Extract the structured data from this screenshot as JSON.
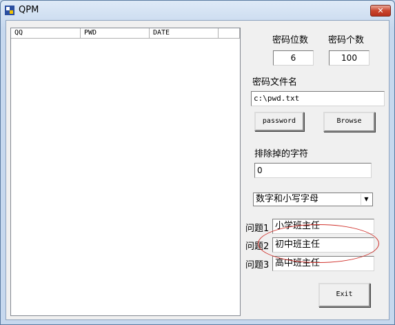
{
  "window": {
    "title": "QPM",
    "close_symbol": "✕"
  },
  "list": {
    "columns": [
      "QQ",
      "PWD",
      "DATE",
      ""
    ]
  },
  "password_length": {
    "label": "密码位数",
    "value": "6"
  },
  "password_count": {
    "label": "密码个数",
    "value": "100"
  },
  "file": {
    "label": "密码文件名",
    "value": "c:\\pwd.txt"
  },
  "buttons": {
    "password": "password",
    "browse": "Browse",
    "exit": "Exit"
  },
  "exclude": {
    "label": "排除掉的字符",
    "value": "0"
  },
  "charset": {
    "selected": "数字和小写字母"
  },
  "questions": [
    {
      "label": "问题1",
      "value": "小学班主任"
    },
    {
      "label": "问题2",
      "value": "初中班主任"
    },
    {
      "label": "问题3",
      "value": "高中班主任"
    }
  ],
  "colors": {
    "annotation": "#d0302a",
    "titlebar": "#c6d8ee"
  }
}
